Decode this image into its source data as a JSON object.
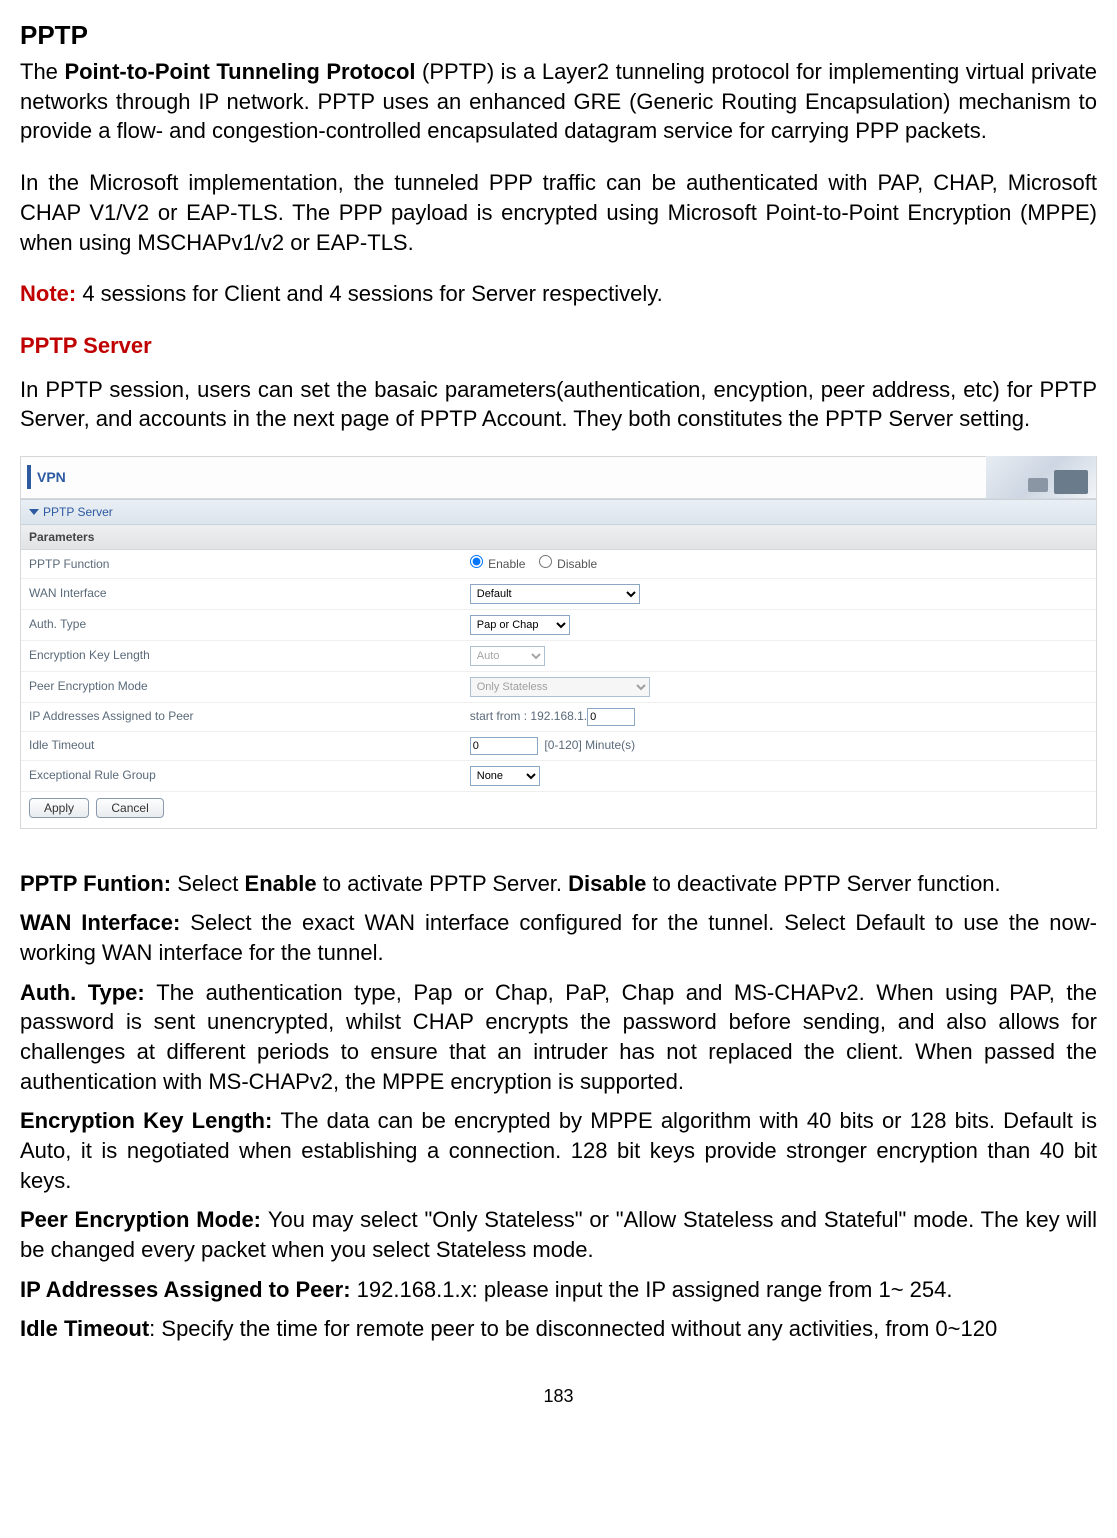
{
  "heading": "PPTP",
  "intro_before_bold": "The ",
  "intro_bold": "Point-to-Point Tunneling Protocol",
  "intro_after_bold": " (PPTP) is a Layer2 tunneling protocol for implementing virtual private networks through IP network. PPTP uses an enhanced GRE (Generic Routing Encapsulation) mechanism to provide a flow- and congestion-controlled encapsulated datagram service for carrying PPP packets.",
  "intro2": "In the Microsoft implementation, the tunneled PPP traffic can be authenticated with PAP, CHAP, Microsoft CHAP V1/V2 or EAP-TLS. The PPP payload is encrypted using Microsoft Point-to-Point Encryption (MPPE) when using MSCHAPv1/v2 or EAP-TLS.",
  "note_label": "Note:",
  "note_text": " 4 sessions for Client and 4 sessions for Server respectively.",
  "subheading": "PPTP Server",
  "subheading_desc": "In PPTP session, users can set the basaic parameters(authentication, encyption, peer address, etc) for PPTP Server, and accounts in the next page of PPTP Account. They both constitutes the PPTP Server setting.",
  "screenshot": {
    "vpn_title": "VPN",
    "section_title": "PPTP Server",
    "params_title": "Parameters",
    "rows": {
      "pptp_function": {
        "label": "PPTP Function",
        "enable": "Enable",
        "disable": "Disable"
      },
      "wan_interface": {
        "label": "WAN Interface",
        "value": "Default"
      },
      "auth_type": {
        "label": "Auth. Type",
        "value": "Pap or Chap"
      },
      "enc_key_len": {
        "label": "Encryption Key Length",
        "value": "Auto"
      },
      "peer_enc_mode": {
        "label": "Peer Encryption Mode",
        "value": "Only Stateless"
      },
      "ip_assigned": {
        "label": "IP Addresses Assigned to Peer",
        "prefix": "start from : 192.168.1.",
        "value": "0"
      },
      "idle_timeout": {
        "label": "Idle Timeout",
        "value": "0",
        "suffix": "[0-120] Minute(s)"
      },
      "exc_rule": {
        "label": "Exceptional Rule Group",
        "value": "None"
      }
    },
    "buttons": {
      "apply": "Apply",
      "cancel": "Cancel"
    }
  },
  "fields": {
    "pptp_function": {
      "label": "PPTP Funtion: ",
      "t1": "Select ",
      "b1": "Enable",
      "t2": " to activate PPTP Server. ",
      "b2": "Disable",
      "t3": " to deactivate PPTP Server function."
    },
    "wan_interface": {
      "label": "WAN Interface: ",
      "text": "Select the exact WAN interface configured for the tunnel. Select Default  to use the now-working WAN interface for the tunnel."
    },
    "auth_type": {
      "label": "Auth. Type: ",
      "text": "The authentication type, Pap or Chap, PaP, Chap and MS-CHAPv2. When using PAP, the password is sent unencrypted, whilst CHAP encrypts the password before sending, and also allows for challenges at different periods to ensure that an intruder has not replaced the client. When passed the authentication with MS-CHAPv2, the MPPE encryption is supported."
    },
    "enc_key_len": {
      "label": "Encryption Key Length: ",
      "text": "The data can be encrypted by MPPE algorithm with 40 bits or 128 bits. Default is Auto, it is negotiated when establishing a connection. 128 bit keys provide stronger encryption than 40 bit keys."
    },
    "peer_enc_mode": {
      "label": "Peer Encryption Mode: ",
      "text": "You may select \"Only Stateless\" or \"Allow Stateless and Stateful\" mode. The key will be changed every packet when you select Stateless mode."
    },
    "ip_assigned": {
      "label": "IP Addresses Assigned to Peer: ",
      "text": "192.168.1.x: please input the IP assigned range from 1~ 254."
    },
    "idle_timeout": {
      "label": "Idle Timeout",
      "text": ": Specify the time for remote peer to be disconnected without any activities, from 0~120"
    }
  },
  "page_number": "183"
}
